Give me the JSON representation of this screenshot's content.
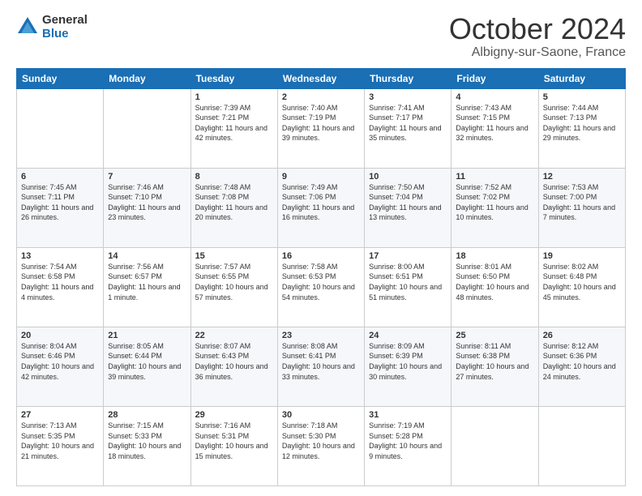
{
  "header": {
    "logo_line1": "General",
    "logo_line2": "Blue",
    "month_title": "October 2024",
    "location": "Albigny-sur-Saone, France"
  },
  "weekdays": [
    "Sunday",
    "Monday",
    "Tuesday",
    "Wednesday",
    "Thursday",
    "Friday",
    "Saturday"
  ],
  "weeks": [
    [
      {
        "day": "",
        "info": ""
      },
      {
        "day": "",
        "info": ""
      },
      {
        "day": "1",
        "info": "Sunrise: 7:39 AM\nSunset: 7:21 PM\nDaylight: 11 hours and 42 minutes."
      },
      {
        "day": "2",
        "info": "Sunrise: 7:40 AM\nSunset: 7:19 PM\nDaylight: 11 hours and 39 minutes."
      },
      {
        "day": "3",
        "info": "Sunrise: 7:41 AM\nSunset: 7:17 PM\nDaylight: 11 hours and 35 minutes."
      },
      {
        "day": "4",
        "info": "Sunrise: 7:43 AM\nSunset: 7:15 PM\nDaylight: 11 hours and 32 minutes."
      },
      {
        "day": "5",
        "info": "Sunrise: 7:44 AM\nSunset: 7:13 PM\nDaylight: 11 hours and 29 minutes."
      }
    ],
    [
      {
        "day": "6",
        "info": "Sunrise: 7:45 AM\nSunset: 7:11 PM\nDaylight: 11 hours and 26 minutes."
      },
      {
        "day": "7",
        "info": "Sunrise: 7:46 AM\nSunset: 7:10 PM\nDaylight: 11 hours and 23 minutes."
      },
      {
        "day": "8",
        "info": "Sunrise: 7:48 AM\nSunset: 7:08 PM\nDaylight: 11 hours and 20 minutes."
      },
      {
        "day": "9",
        "info": "Sunrise: 7:49 AM\nSunset: 7:06 PM\nDaylight: 11 hours and 16 minutes."
      },
      {
        "day": "10",
        "info": "Sunrise: 7:50 AM\nSunset: 7:04 PM\nDaylight: 11 hours and 13 minutes."
      },
      {
        "day": "11",
        "info": "Sunrise: 7:52 AM\nSunset: 7:02 PM\nDaylight: 11 hours and 10 minutes."
      },
      {
        "day": "12",
        "info": "Sunrise: 7:53 AM\nSunset: 7:00 PM\nDaylight: 11 hours and 7 minutes."
      }
    ],
    [
      {
        "day": "13",
        "info": "Sunrise: 7:54 AM\nSunset: 6:58 PM\nDaylight: 11 hours and 4 minutes."
      },
      {
        "day": "14",
        "info": "Sunrise: 7:56 AM\nSunset: 6:57 PM\nDaylight: 11 hours and 1 minute."
      },
      {
        "day": "15",
        "info": "Sunrise: 7:57 AM\nSunset: 6:55 PM\nDaylight: 10 hours and 57 minutes."
      },
      {
        "day": "16",
        "info": "Sunrise: 7:58 AM\nSunset: 6:53 PM\nDaylight: 10 hours and 54 minutes."
      },
      {
        "day": "17",
        "info": "Sunrise: 8:00 AM\nSunset: 6:51 PM\nDaylight: 10 hours and 51 minutes."
      },
      {
        "day": "18",
        "info": "Sunrise: 8:01 AM\nSunset: 6:50 PM\nDaylight: 10 hours and 48 minutes."
      },
      {
        "day": "19",
        "info": "Sunrise: 8:02 AM\nSunset: 6:48 PM\nDaylight: 10 hours and 45 minutes."
      }
    ],
    [
      {
        "day": "20",
        "info": "Sunrise: 8:04 AM\nSunset: 6:46 PM\nDaylight: 10 hours and 42 minutes."
      },
      {
        "day": "21",
        "info": "Sunrise: 8:05 AM\nSunset: 6:44 PM\nDaylight: 10 hours and 39 minutes."
      },
      {
        "day": "22",
        "info": "Sunrise: 8:07 AM\nSunset: 6:43 PM\nDaylight: 10 hours and 36 minutes."
      },
      {
        "day": "23",
        "info": "Sunrise: 8:08 AM\nSunset: 6:41 PM\nDaylight: 10 hours and 33 minutes."
      },
      {
        "day": "24",
        "info": "Sunrise: 8:09 AM\nSunset: 6:39 PM\nDaylight: 10 hours and 30 minutes."
      },
      {
        "day": "25",
        "info": "Sunrise: 8:11 AM\nSunset: 6:38 PM\nDaylight: 10 hours and 27 minutes."
      },
      {
        "day": "26",
        "info": "Sunrise: 8:12 AM\nSunset: 6:36 PM\nDaylight: 10 hours and 24 minutes."
      }
    ],
    [
      {
        "day": "27",
        "info": "Sunrise: 7:13 AM\nSunset: 5:35 PM\nDaylight: 10 hours and 21 minutes."
      },
      {
        "day": "28",
        "info": "Sunrise: 7:15 AM\nSunset: 5:33 PM\nDaylight: 10 hours and 18 minutes."
      },
      {
        "day": "29",
        "info": "Sunrise: 7:16 AM\nSunset: 5:31 PM\nDaylight: 10 hours and 15 minutes."
      },
      {
        "day": "30",
        "info": "Sunrise: 7:18 AM\nSunset: 5:30 PM\nDaylight: 10 hours and 12 minutes."
      },
      {
        "day": "31",
        "info": "Sunrise: 7:19 AM\nSunset: 5:28 PM\nDaylight: 10 hours and 9 minutes."
      },
      {
        "day": "",
        "info": ""
      },
      {
        "day": "",
        "info": ""
      }
    ]
  ]
}
